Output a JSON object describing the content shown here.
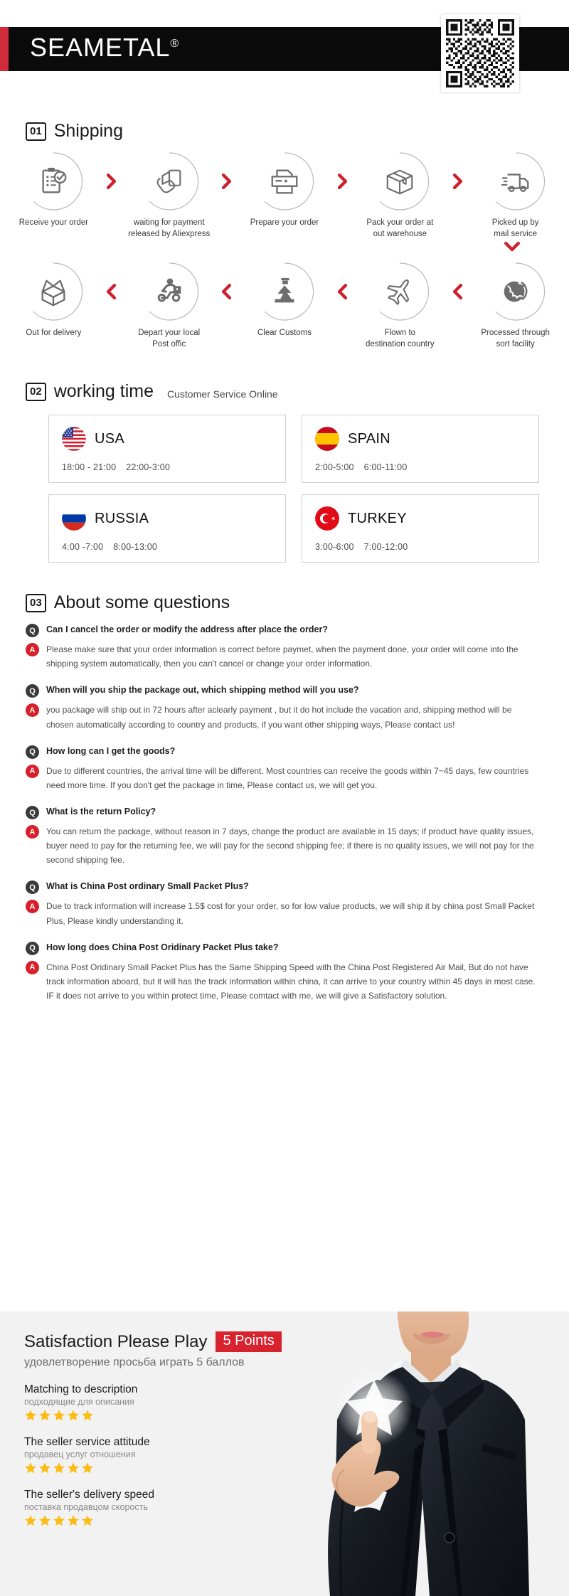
{
  "header": {
    "brand": "SEAMETAL",
    "registered_mark": "®",
    "qr_alt": "qr-code"
  },
  "shipping": {
    "number": "01",
    "title": "Shipping",
    "row1": [
      {
        "icon": "clipboard-check-icon",
        "label": "Receive your order"
      },
      {
        "icon": "hand-card-icon",
        "label": "waiting for payment\nreleased by Aliexpress"
      },
      {
        "icon": "printer-icon",
        "label": "Prepare your order"
      },
      {
        "icon": "box-icon",
        "label": "Pack your order at\nout warehouse"
      },
      {
        "icon": "truck-icon",
        "label": "Picked up by\nmail service"
      }
    ],
    "row2": [
      {
        "icon": "open-box-icon",
        "label": "Out  for delivery"
      },
      {
        "icon": "scooter-courier-icon",
        "label": "Depart your local\nPost offic"
      },
      {
        "icon": "customs-officer-icon",
        "label": "Clear Customs"
      },
      {
        "icon": "airplane-icon",
        "label": "Flown to\ndestination country"
      },
      {
        "icon": "globe-arrow-icon",
        "label": "Processed through\nsort facility"
      }
    ],
    "arrow_right": "chevron-right-icon",
    "arrow_left": "chevron-left-icon",
    "arrow_down": "chevron-down-icon"
  },
  "working_time": {
    "number": "02",
    "title": "working time",
    "subtitle": "Customer Service Online",
    "cards": [
      {
        "flag": "flag-usa-icon",
        "country": "USA",
        "hours": [
          "18:00 - 21:00",
          "22:00-3:00"
        ]
      },
      {
        "flag": "flag-spain-icon",
        "country": "SPAIN",
        "hours": [
          "2:00-5:00",
          "6:00-11:00"
        ]
      },
      {
        "flag": "flag-russia-icon",
        "country": "RUSSIA",
        "hours": [
          "4:00 -7:00",
          "8:00-13:00"
        ]
      },
      {
        "flag": "flag-turkey-icon",
        "country": "TURKEY",
        "hours": [
          "3:00-6:00",
          "7:00-12:00"
        ]
      }
    ]
  },
  "faq": {
    "number": "03",
    "title": "About some questions",
    "q_badge": "Q",
    "a_badge": "A",
    "items": [
      {
        "question": "Can I cancel the order or modify the address after place the order?",
        "answer": "Please make sure that your order information is correct before paymet, when the payment done, your order will come into the shipping system automatically, then you can't cancel or change your order information."
      },
      {
        "question": "When will you ship the package out, which shipping method will you use?",
        "answer": "you package will ship out in 72 hours after aclearly payment , but it do hot include the vacation and, shipping method will be chosen automatically according to country and products, if you want other shipping ways, Please contact us!"
      },
      {
        "question": "How long can I get the goods?",
        "answer": "Due to different countries, the arrival time will be different. Most countries can receive the goods within 7~45 days, few countries need more time. If you don't get the package in time, Please contact us, we will get you."
      },
      {
        "question": "What is the return Policy?",
        "answer": "You can return the package, without reason in 7 days, change the product are available in 15 days; if product have quality issues, buyer need to pay for the returning fee, we will pay for the second shipping fee; if there is no quality issues, we will not pay for the second shipping fee."
      },
      {
        "question": "What is China Post ordinary Small Packet Plus?",
        "answer": "Due to track information will increase 1.5$ cost for your order, so for low value products, we will ship it by china post Small Packet Plus, Please kindly understanding it."
      },
      {
        "question": "How long does China Post Oridinary Packet Plus take?",
        "answer": "China Post Oridinary Small Packet Plus has the Same Shipping Speed with the China Post Registered Air Mail, But do not have track information aboard, but it will has the track information within china, it can arrive to your country within 45 days in most case. IF it does not arrive to you within protect time, Please comtact with me, we will give a Satisfactory solution."
      }
    ]
  },
  "satisfaction": {
    "title": "Satisfaction Please Play",
    "points_badge": "5 Points",
    "subtitle": "удовлетворение просьба играть 5 баллов",
    "ratings": [
      {
        "en": "Matching to description",
        "ru": "подходящие для описания",
        "stars": 5
      },
      {
        "en": "The seller service attitude",
        "ru": "продавец услуг отношения",
        "stars": 5
      },
      {
        "en": "The seller's delivery speed",
        "ru": "поставка продавцом скорость",
        "stars": 5
      }
    ],
    "image": "businessman-pressing-star-photo"
  },
  "colors": {
    "brand_red": "#cf2b3a",
    "arrow_red": "#cf1f2c",
    "badge_q": "#3a3a3a",
    "badge_a": "#d81f2a",
    "pill_red": "#d8222e",
    "star_yellow": "#fbbc15",
    "header_black": "#0b0b0b",
    "footer_bg": "#f2f2f2"
  }
}
